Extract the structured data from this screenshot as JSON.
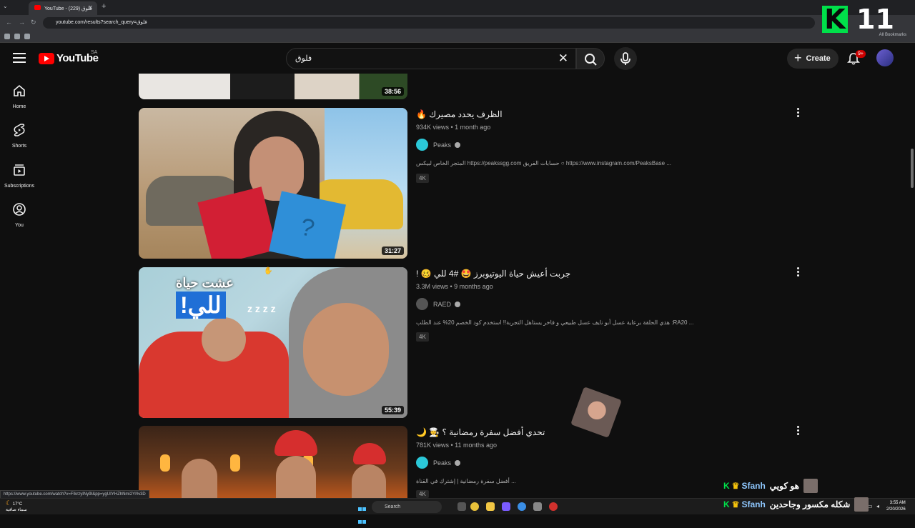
{
  "browser": {
    "tab_title": "YouTube - فلوق (229)",
    "url": "youtube.com/results?search_query=فلوق",
    "all_bookmarks": "All Bookmarks",
    "status_url": "https://www.youtube.com/watch?v=FIkrzyINy9I&pp=ygUIYHZhNmi2YI%3D"
  },
  "header": {
    "logo_text": "YouTube",
    "region": "SA",
    "search_query": "فلوق",
    "create_label": "Create",
    "notifications_badge": "9+"
  },
  "overlay": {
    "k_letter": "K",
    "number": "11"
  },
  "sidebar": {
    "items": [
      {
        "label": "Home",
        "icon": "home-icon"
      },
      {
        "label": "Shorts",
        "icon": "shorts-icon"
      },
      {
        "label": "Subscriptions",
        "icon": "subscriptions-icon"
      },
      {
        "label": "You",
        "icon": "you-icon"
      }
    ]
  },
  "results": [
    {
      "duration": "38:56"
    },
    {
      "title": "الظرف يحدد مصيرك 🔥",
      "meta": "934K views • 1 month ago",
      "channel": "Peaks",
      "description": "المتجر الخاص لبيكس https://peakssgg.com حسابات الفريق ○ https://www.instagram.com/PeaksBase ...",
      "badge": "4K",
      "duration": "31:27",
      "thumb_overlay": "?"
    },
    {
      "title": "جربت أعيش حياة اليوتيوبرز 🤩 #4 للي 🥴 !",
      "meta": "3.3M views • 9 months ago",
      "channel": "RAED",
      "description": "هذي الحلقة برعاية عسل أبو نايف عسل طبيعي و فاخر يستاهل التجربة!! استخدم كود الخصم 20% عند الطلب :RA20 ...",
      "badge": "4K",
      "duration": "55:39",
      "thumb_text_1": "عشت حياة",
      "thumb_text_2": "للي!",
      "thumb_zzz": "z z z z"
    },
    {
      "title": "تحدي أفضل سفرة رمضانية ؟ 🧑‍🍳 🌙",
      "meta": "781K views • 11 months ago",
      "channel": "Peaks",
      "description": "أفضل سفرة رمضانية | إشترك في القناة ...",
      "badge": "4K"
    }
  ],
  "chat": [
    {
      "name": "Sfanh",
      "message": "هو كويي"
    },
    {
      "name": "Sfanh",
      "message": "شكله مكسور وجاحدين"
    }
  ],
  "taskbar": {
    "temperature": "17°C",
    "weather_text": "سماء صافية",
    "search_placeholder": "Search",
    "time": "3:55 AM",
    "date": "2/20/2026"
  },
  "colors": {
    "background": "#0f0f0f",
    "brand_red": "#ff0000",
    "overlay_green": "#00e04a"
  }
}
